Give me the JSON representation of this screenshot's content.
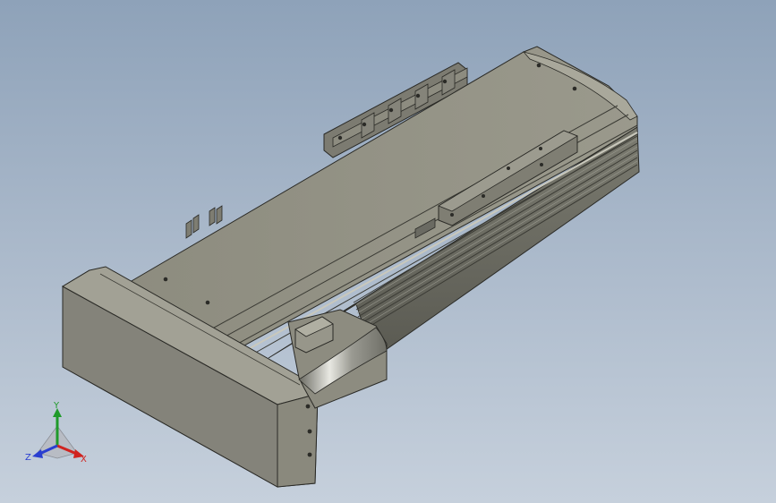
{
  "viewport": {
    "background_top": "#8ea2b9",
    "background_bottom": "#c6d0dc",
    "model": "linear-actuator-stage"
  },
  "triad": {
    "x_label": "X",
    "y_label": "Y",
    "z_label": "Z",
    "x_color": "#d0231f",
    "y_color": "#1f9a2a",
    "z_color": "#2a3fd0"
  }
}
